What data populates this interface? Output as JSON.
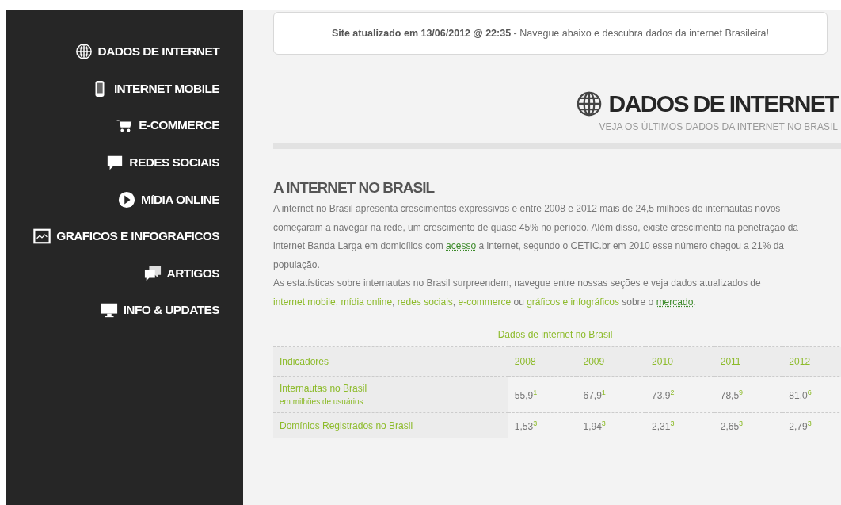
{
  "sidebar": {
    "items": [
      {
        "label": "DADOS DE INTERNET"
      },
      {
        "label": "INTERNET MOBILE"
      },
      {
        "label": "E-COMMERCE"
      },
      {
        "label": "REDES SOCIAIS"
      },
      {
        "label": "MíDIA ONLINE"
      },
      {
        "label": "GRAFICOS E INFOGRAFICOS"
      },
      {
        "label": "ARTIGOS"
      },
      {
        "label": "INFO & UPDATES"
      }
    ]
  },
  "banner": {
    "text": "**Site atualizado em 13/06/2012 @ 22:35** - Navegue abaixo e descubra dados da internet Brasileira!"
  },
  "page_header": {
    "title": "DADOS DE INTERNET",
    "subtitle": "VEJA OS ÚLTIMOS DADOS DA INTERNET NO BRASIL"
  },
  "section": {
    "title": "A INTERNET NO BRASIL",
    "paragraphs": [
      [
        {
          "kind": "text",
          "text": "A internet no Brasil apresenta crescimentos expressivos e entre 2008 e 2012 mais de 24,5 milhões de internautas novos começaram a navegar na rede, um crescimento de quase 45% no período. Além disso, existe crescimento na penetração da internet Banda Larga em domicílios com "
        },
        {
          "kind": "underlined-link",
          "text": "acesso"
        },
        {
          "kind": "text",
          "text": " a internet, segundo o CETIC.br em 2010 esse número chegou a 21% da população."
        }
      ],
      [
        {
          "kind": "text",
          "text": "As estatísticas sobre internautas no Brasil surpreendem, navegue entre nossas seções e veja dados atualizados de "
        },
        {
          "kind": "link",
          "text": "internet mobile"
        },
        {
          "kind": "text",
          "text": ", "
        },
        {
          "kind": "link",
          "text": "mídia online"
        },
        {
          "kind": "text",
          "text": ", "
        },
        {
          "kind": "link",
          "text": "redes sociais"
        },
        {
          "kind": "text",
          "text": ", "
        },
        {
          "kind": "link",
          "text": "e-commerce"
        },
        {
          "kind": "text",
          "text": " ou "
        },
        {
          "kind": "link",
          "text": "gráficos e infográficos"
        },
        {
          "kind": "text",
          "text": "  sobre o "
        },
        {
          "kind": "underlined-link",
          "text": "mercado"
        },
        {
          "kind": "text",
          "text": "."
        }
      ]
    ]
  },
  "table": {
    "caption": "Dados de internet no Brasil",
    "columns": [
      "Indicadores",
      "2008",
      "2009",
      "2010",
      "2011",
      "2012"
    ],
    "rows": [
      {
        "label": "Internautas no Brasil",
        "note": "em milhões de usuários",
        "values": [
          "55,9$^{1}$",
          "67,9$^{1}$",
          "73,9$^{2}$",
          "78,5$^{9}$",
          "81,0$^{6}$"
        ]
      },
      {
        "label": "Domínios Registrados no Brasil",
        "values": [
          "1,53$^{3}$",
          "1,94$^{3}$",
          "2,31$^{3}$",
          "2,65$^{3}$",
          "2,79$^{3}$"
        ]
      }
    ]
  }
}
